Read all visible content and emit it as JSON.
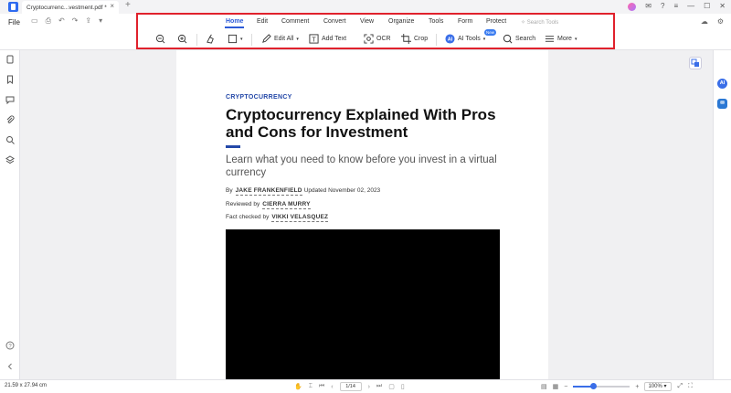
{
  "tab": {
    "title": "Cryptocurrenc...vestment.pdf *",
    "close": "×",
    "new": "+"
  },
  "filebar": {
    "file_label": "File"
  },
  "ribbon": {
    "menu": [
      "Home",
      "Edit",
      "Comment",
      "Convert",
      "View",
      "Organize",
      "Tools",
      "Form",
      "Protect"
    ],
    "search_tools": "Search Tools",
    "tools": {
      "edit_all": "Edit All",
      "add_text": "Add Text",
      "ocr": "OCR",
      "crop": "Crop",
      "ai_tools": "AI Tools",
      "search": "Search",
      "more": "More"
    },
    "new_badge": "New"
  },
  "document": {
    "kicker": "CRYPTOCURRENCY",
    "title": "Cryptocurrency Explained With Pros and Cons for Investment",
    "subtitle": "Learn what you need to know before you invest in a virtual currency",
    "by_prefix": "By",
    "author": "JAKE FRANKENFIELD",
    "updated": "Updated November 02, 2023",
    "reviewed_prefix": "Reviewed by",
    "reviewer": "CIERRA MURRY",
    "fact_prefix": "Fact checked by",
    "fact_checker": "VIKKI VELASQUEZ"
  },
  "sidebar_right": {
    "ai_label": "AI"
  },
  "status": {
    "dimensions": "21.59 x 27.94 cm",
    "page": "1/14",
    "zoom": "100%",
    "zoom_fraction": 0.35
  },
  "colors": {
    "accent": "#2d5bd8",
    "highlight": "#e0212c",
    "kicker": "#2448a8"
  }
}
